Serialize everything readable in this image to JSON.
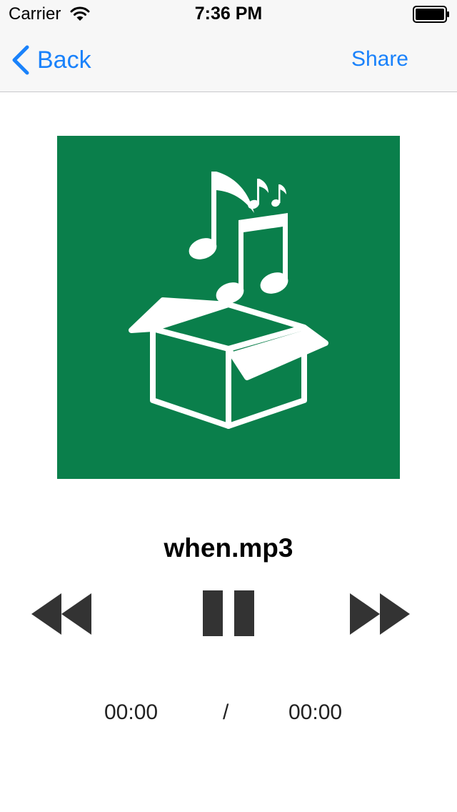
{
  "status_bar": {
    "carrier": "Carrier",
    "time": "7:36 PM",
    "icons": [
      "wifi-icon",
      "battery-icon"
    ]
  },
  "nav": {
    "back_label": "Back",
    "share_label": "Share",
    "accent_color": "#1a82fb"
  },
  "artwork": {
    "background_color": "#0a7f4b",
    "icon": "music-box-icon"
  },
  "player": {
    "track_title": "when.mp3",
    "current_time": "00:00",
    "separator": "/",
    "total_time": "00:00",
    "controls": [
      "rewind-icon",
      "pause-icon",
      "fast-forward-icon"
    ]
  }
}
